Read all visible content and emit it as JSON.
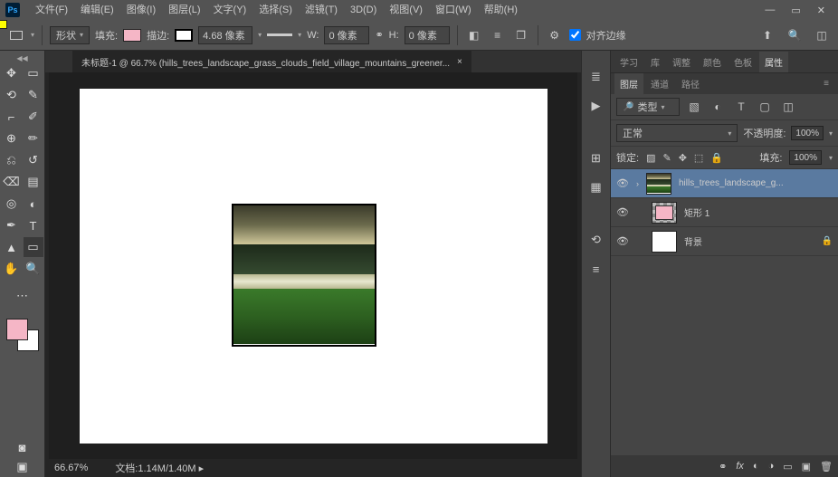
{
  "app": {
    "logo": "Ps"
  },
  "menu": {
    "file": "文件(F)",
    "edit": "编辑(E)",
    "image": "图像(I)",
    "layer": "图层(L)",
    "type": "文字(Y)",
    "select": "选择(S)",
    "filter": "滤镜(T)",
    "threeD": "3D(D)",
    "view": "视图(V)",
    "window": "窗口(W)",
    "help": "帮助(H)"
  },
  "options": {
    "shapeMode": "形状",
    "fillLabel": "填充:",
    "strokeLabel": "描边:",
    "strokeWidth": "4.68 像素",
    "wLabel": "W:",
    "wVal": "0 像素",
    "hLabel": "H:",
    "hVal": "0 像素",
    "alignEdges": "对齐边缘"
  },
  "documentTab": "未标题-1 @ 66.7% (hills_trees_landscape_grass_clouds_field_village_mountains_greener...",
  "status": {
    "zoom": "66.67%",
    "docLabel": "文档:",
    "docSize": "1.14M/1.40M"
  },
  "propTabs": {
    "study": "学习",
    "library": "库",
    "adjust": "调整",
    "color": "颜色",
    "swatch": "色板",
    "props": "属性"
  },
  "layersTabs": {
    "layers": "图层",
    "channels": "通道",
    "paths": "路径"
  },
  "layerPanel": {
    "kind": "类型",
    "blend": "正常",
    "opacityLabel": "不透明度:",
    "opacity": "100%",
    "lockLabel": "锁定:",
    "fillLabel": "填充:",
    "fill": "100%"
  },
  "layers": [
    {
      "name": "hills_trees_landscape_g..."
    },
    {
      "name": "矩形 1"
    },
    {
      "name": "背景"
    }
  ]
}
